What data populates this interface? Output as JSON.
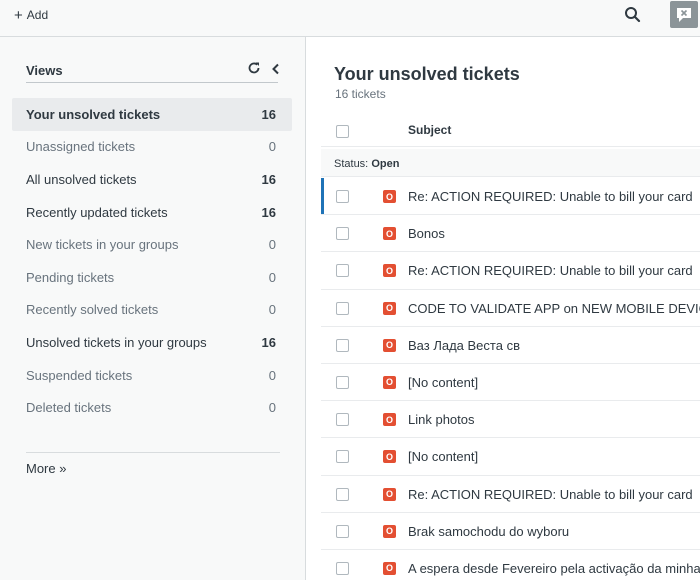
{
  "topbar": {
    "add_label": "Add",
    "add_icon": "plus-icon",
    "search_icon": "search-icon",
    "conversations_icon": "chat-bubble-close-icon"
  },
  "sidebar": {
    "title": "Views",
    "items": [
      {
        "label": "Your unsolved tickets",
        "count": "16",
        "state": "active"
      },
      {
        "label": "Unassigned tickets",
        "count": "0",
        "state": "muted"
      },
      {
        "label": "All unsolved tickets",
        "count": "16",
        "state": "bold"
      },
      {
        "label": "Recently updated tickets",
        "count": "16",
        "state": "bold"
      },
      {
        "label": "New tickets in your groups",
        "count": "0",
        "state": "muted"
      },
      {
        "label": "Pending tickets",
        "count": "0",
        "state": "muted"
      },
      {
        "label": "Recently solved tickets",
        "count": "0",
        "state": "muted"
      },
      {
        "label": "Unsolved tickets in your groups",
        "count": "16",
        "state": "bold"
      },
      {
        "label": "Suspended tickets",
        "count": "0",
        "state": "muted"
      },
      {
        "label": "Deleted tickets",
        "count": "0",
        "state": "muted"
      }
    ],
    "more_label": "More »"
  },
  "main": {
    "title": "Your unsolved tickets",
    "subtitle": "16 tickets",
    "column_subject": "Subject",
    "status_prefix": "Status:",
    "status_value": "Open",
    "badge_color": "#e34f32",
    "tickets": [
      {
        "status": "O",
        "subject": "Re: ACTION REQUIRED: Unable to bill your card"
      },
      {
        "status": "O",
        "subject": "Bonos"
      },
      {
        "status": "O",
        "subject": "Re: ACTION REQUIRED: Unable to bill your card"
      },
      {
        "status": "O",
        "subject": "CODE TO VALIDATE APP on NEW MOBILE DEVICE"
      },
      {
        "status": "O",
        "subject": "Ваз Лада Веста св"
      },
      {
        "status": "O",
        "subject": "[No content]"
      },
      {
        "status": "O",
        "subject": "Link photos"
      },
      {
        "status": "O",
        "subject": "[No content]"
      },
      {
        "status": "O",
        "subject": "Re: ACTION REQUIRED: Unable to bill your card"
      },
      {
        "status": "O",
        "subject": "Brak samochodu do wyboru"
      },
      {
        "status": "O",
        "subject": "A espera desde Fevereiro pela activação da minha"
      }
    ]
  }
}
